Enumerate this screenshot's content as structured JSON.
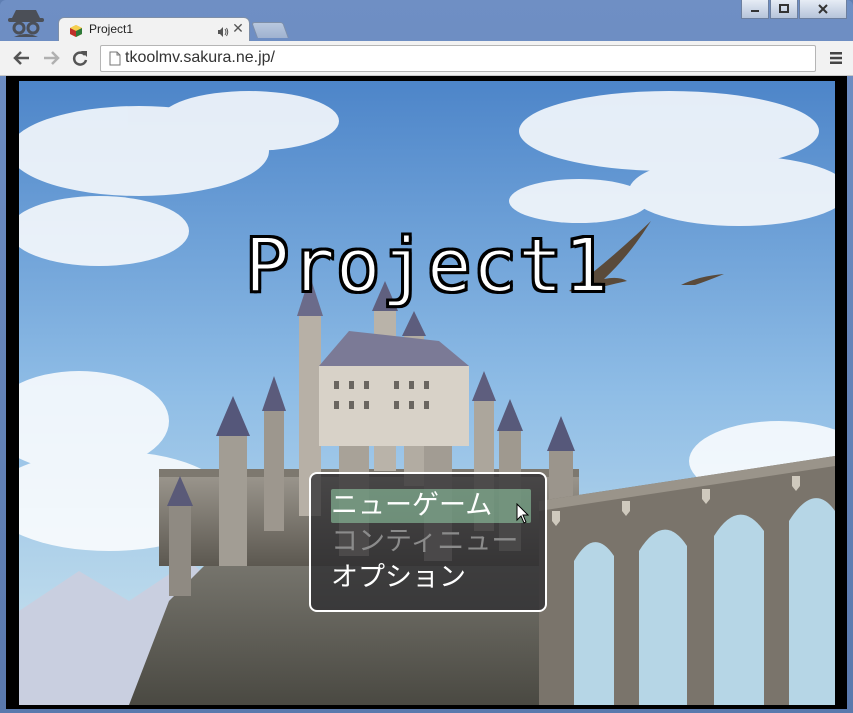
{
  "browser": {
    "tab_title": "Project1",
    "url": "tkoolmv.sakura.ne.jp/",
    "icons": {
      "incognito": "incognito-icon",
      "favicon": "rpgmaker-favicon-icon",
      "audio": "speaker-icon",
      "close_tab": "close-icon",
      "back": "back-arrow-icon",
      "forward": "forward-arrow-icon",
      "reload": "reload-icon",
      "page": "page-icon",
      "menu": "hamburger-menu-icon",
      "minimize": "minimize-icon",
      "maximize": "maximize-icon",
      "close_window": "close-icon"
    },
    "close_glyph": "✕"
  },
  "game": {
    "title": "Project1",
    "menu": [
      {
        "label": "ニューゲーム",
        "selected": true,
        "enabled": true
      },
      {
        "label": "コンティニュー",
        "selected": false,
        "enabled": false
      },
      {
        "label": "オプション",
        "selected": false,
        "enabled": true
      }
    ]
  },
  "colors": {
    "frame": "#6f8fc4",
    "sky_top": "#5b8fcf",
    "menu_highlight": "#96d2aa",
    "disabled_text": "#8b8b8b"
  }
}
